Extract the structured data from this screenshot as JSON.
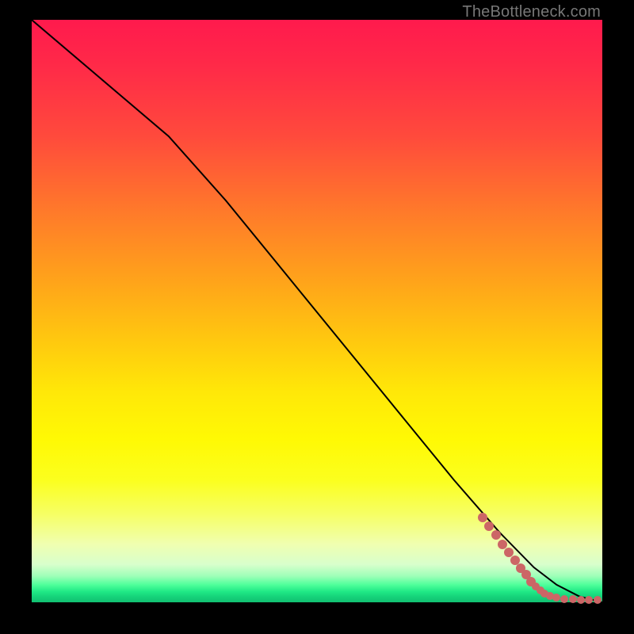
{
  "attribution": "TheBottleneck.com",
  "chart_data": {
    "type": "line",
    "title": "",
    "xlabel": "",
    "ylabel": "",
    "xlim": [
      0,
      100
    ],
    "ylim": [
      0,
      100
    ],
    "series": [
      {
        "name": "curve",
        "style": "black-line",
        "x": [
          0,
          12,
          24,
          34,
          44,
          54,
          64,
          74,
          82,
          88,
          92,
          96,
          100
        ],
        "y": [
          100,
          90,
          80,
          69,
          57,
          45,
          33,
          21,
          12,
          6,
          3,
          1,
          0
        ]
      }
    ],
    "scatter_series": [
      {
        "name": "points",
        "style": "salmon-dot",
        "points": [
          {
            "x": 79.0,
            "y": 14.5,
            "r": 6
          },
          {
            "x": 80.2,
            "y": 13.0,
            "r": 6
          },
          {
            "x": 81.4,
            "y": 11.5,
            "r": 6
          },
          {
            "x": 82.5,
            "y": 10.0,
            "r": 6
          },
          {
            "x": 83.6,
            "y": 8.6,
            "r": 6
          },
          {
            "x": 84.7,
            "y": 7.2,
            "r": 6
          },
          {
            "x": 85.7,
            "y": 5.9,
            "r": 6
          },
          {
            "x": 86.6,
            "y": 4.7,
            "r": 6
          },
          {
            "x": 87.5,
            "y": 3.6,
            "r": 6
          },
          {
            "x": 88.3,
            "y": 2.7,
            "r": 5
          },
          {
            "x": 89.1,
            "y": 2.0,
            "r": 5
          },
          {
            "x": 89.9,
            "y": 1.5,
            "r": 5
          },
          {
            "x": 90.8,
            "y": 1.1,
            "r": 5
          },
          {
            "x": 92.0,
            "y": 0.8,
            "r": 5
          },
          {
            "x": 93.3,
            "y": 0.6,
            "r": 5
          },
          {
            "x": 94.8,
            "y": 0.5,
            "r": 5
          },
          {
            "x": 96.2,
            "y": 0.4,
            "r": 5
          },
          {
            "x": 97.6,
            "y": 0.4,
            "r": 5
          },
          {
            "x": 99.2,
            "y": 0.4,
            "r": 5
          }
        ]
      }
    ],
    "background": {
      "type": "vertical-gradient",
      "stops": [
        {
          "pos": 0.0,
          "color": "#ff1a4d"
        },
        {
          "pos": 0.45,
          "color": "#ffa41a"
        },
        {
          "pos": 0.72,
          "color": "#fff904"
        },
        {
          "pos": 0.93,
          "color": "#d8ffcc"
        },
        {
          "pos": 1.0,
          "color": "#12c072"
        }
      ]
    },
    "colors": {
      "curve": "#000000",
      "points": "#cc6666",
      "frame": "#000000"
    }
  }
}
